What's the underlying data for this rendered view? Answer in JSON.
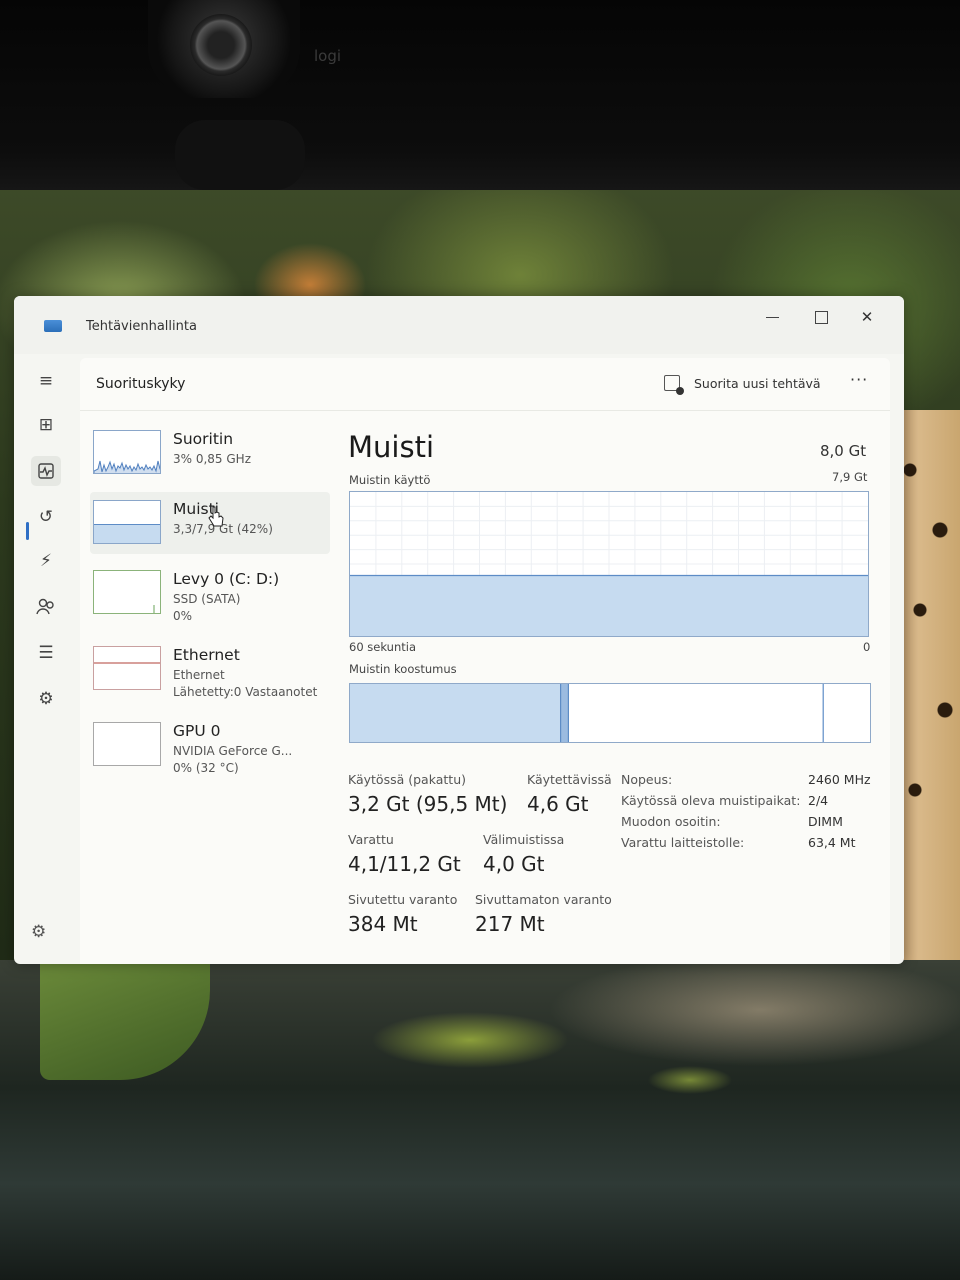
{
  "window": {
    "title": "Tehtävienhallinta"
  },
  "window_controls": {
    "close": "✕"
  },
  "page": {
    "title": "Suorituskyky"
  },
  "toolbar": {
    "run_new_task": "Suorita uusi tehtävä",
    "more": "···"
  },
  "devices": [
    {
      "name": "Suoritin",
      "sub1": "3% 0,85 GHz",
      "sub2": ""
    },
    {
      "name": "Muisti",
      "sub1": "3,3/7,9 Gt (42%)",
      "sub2": "",
      "usage_percent": 42
    },
    {
      "name": "Levy 0 (C: D:)",
      "sub1": "SSD (SATA)",
      "sub2": "0%"
    },
    {
      "name": "Ethernet",
      "sub1": "Ethernet",
      "sub2": "Lähetetty:0 Vastaanotet"
    },
    {
      "name": "GPU 0",
      "sub1": "NVIDIA GeForce G...",
      "sub2": "0% (32 °C)"
    }
  ],
  "memory": {
    "title": "Muisti",
    "total": "8,0 Gt",
    "usage_label": "Muistin käyttö",
    "usage_max": "7,9 Gt",
    "time_left": "60 sekuntia",
    "time_right": "0",
    "composition_label": "Muistin koostumus",
    "usage_fraction": 0.42,
    "composition": {
      "in_use_fraction": 0.405,
      "modified_fraction": 0.015,
      "standby_fraction": 0.49
    }
  },
  "stats": {
    "in_use_label": "Käytössä (pakattu)",
    "in_use_value": "3,2 Gt (95,5 Mt)",
    "available_label": "Käytettävissä",
    "available_value": "4,6 Gt",
    "committed_label": "Varattu",
    "committed_value": "4,1/11,2 Gt",
    "cached_label": "Välimuistissa",
    "cached_value": "4,0 Gt",
    "paged_label": "Sivutettu varanto",
    "paged_value": "384 Mt",
    "nonpaged_label": "Sivuttamaton varanto",
    "nonpaged_value": "217 Mt"
  },
  "specs": [
    {
      "key": "Nopeus:",
      "value": "2460 MHz"
    },
    {
      "key": "Käytössä oleva muistipaikat:",
      "value": "2/4"
    },
    {
      "key": "Muodon osoitin:",
      "value": "DIMM"
    },
    {
      "key": "Varattu laitteistolle:",
      "value": "63,4 Mt"
    }
  ],
  "webcam": {
    "brand": "logi"
  },
  "colors": {
    "accent": "#2f6fc5",
    "memory_fill": "#c6dbf0",
    "graph_border": "#8fa9c9",
    "ethernet_line": "#b0403a"
  },
  "icons": {
    "hamburger": "≡",
    "processes": "⊞",
    "performance": "⏶",
    "history": "↺",
    "startup": "⚡",
    "users": "👥",
    "details": "☰",
    "services": "⚙",
    "settings": "⚙"
  }
}
